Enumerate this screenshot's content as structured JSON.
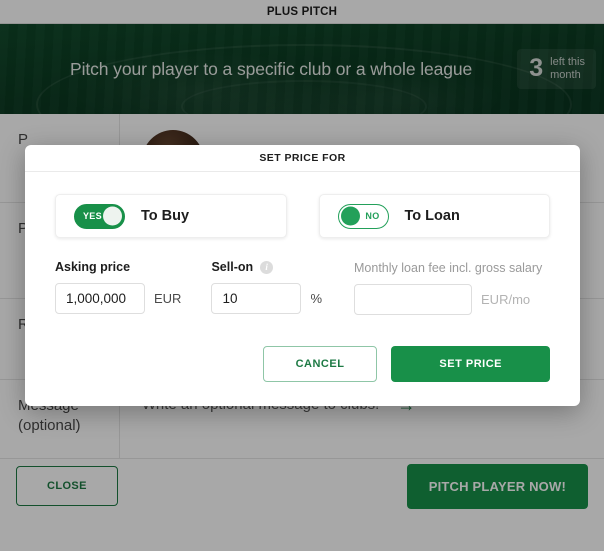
{
  "titlebar": {
    "title": "PLUS PITCH"
  },
  "hero": {
    "headline": "Pitch your player to a specific club or a whole league",
    "badge_count": "3",
    "badge_label_line1": "left this",
    "badge_label_line2": "month"
  },
  "background_form": {
    "rows": [
      {
        "label": "P"
      },
      {
        "label": "P"
      },
      {
        "label": "R"
      },
      {
        "label": "Message (optional)",
        "value": "Write an optional message to clubs!",
        "arrow": "→"
      }
    ]
  },
  "page_footer": {
    "close_label": "CLOSE",
    "pitch_label": "PITCH PLAYER NOW!"
  },
  "modal": {
    "title": "SET PRICE FOR",
    "buy": {
      "toggle_state": "YES",
      "toggle_on": true,
      "label": "To Buy",
      "asking_price": {
        "label": "Asking price",
        "value": "1,000,000",
        "unit": "EUR"
      },
      "sell_on": {
        "label": "Sell-on",
        "info_icon_glyph": "i",
        "value": "10",
        "unit": "%"
      }
    },
    "loan": {
      "toggle_state": "NO",
      "toggle_on": false,
      "label": "To Loan",
      "fee": {
        "label": "Monthly loan fee incl. gross salary",
        "value": "",
        "placeholder": "",
        "unit": "EUR/mo"
      }
    },
    "footer": {
      "cancel_label": "CANCEL",
      "set_price_label": "SET PRICE"
    }
  },
  "colors": {
    "brand_green": "#189049",
    "dark_green": "#0c3c22",
    "link_green": "#1d7a44"
  }
}
